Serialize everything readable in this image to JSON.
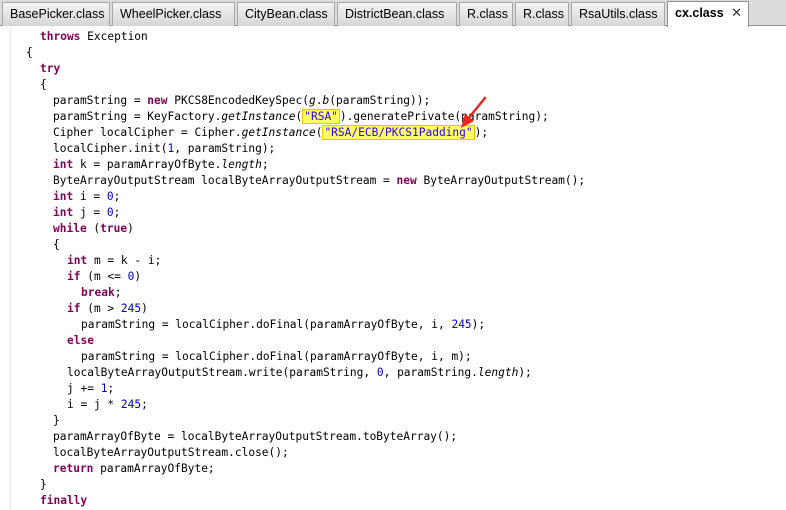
{
  "tabs": [
    {
      "label": "BasePicker.class"
    },
    {
      "label": "WheelPicker.class"
    },
    {
      "label": "CityBean.class"
    },
    {
      "label": "DistrictBean.class"
    },
    {
      "label": "R.class"
    },
    {
      "label": "R.class"
    },
    {
      "label": "RsaUtils.class"
    },
    {
      "label": "cx.class",
      "active": true,
      "close": "✕"
    }
  ],
  "code": {
    "l0": {
      "kw1": "throws",
      "t1": " Exception"
    },
    "l1": {
      "t1": "{"
    },
    "l2": {
      "kw1": "try"
    },
    "l3": {
      "t1": "{"
    },
    "l4": {
      "t1": "paramString = ",
      "kw1": "new",
      "t2": " PKCS8EncodedKeySpec(",
      "it1": "g",
      "t3": ".",
      "it2": "b",
      "t4": "(paramString));"
    },
    "l5": {
      "t1": "paramString = KeyFactory.",
      "it1": "getInstance",
      "t2": "(",
      "s1": "\"RSA\"",
      "t3": ").generatePrivate(paramString);"
    },
    "l6": {
      "t1": "Cipher localCipher = Cipher.",
      "it1": "getInstance",
      "t2": "(",
      "s1": "\"RSA/ECB/PKCS1Padding\"",
      "t3": ");"
    },
    "l7": {
      "t1": "localCipher.init(",
      "n1": "1",
      "t2": ", paramString);"
    },
    "l8": {
      "kw1": "int",
      "t1": " k = paramArrayOfByte.",
      "it1": "length",
      "t2": ";"
    },
    "l9": {
      "t1": "ByteArrayOutputStream localByteArrayOutputStream = ",
      "kw1": "new",
      "t2": " ByteArrayOutputStream();"
    },
    "l10": {
      "kw1": "int",
      "t1": " i = ",
      "n1": "0",
      "t2": ";"
    },
    "l11": {
      "kw1": "int",
      "t1": " j = ",
      "n1": "0",
      "t2": ";"
    },
    "l12": {
      "kw1": "while",
      "t1": " (",
      "kw2": "true",
      "t2": ")"
    },
    "l13": {
      "t1": "{"
    },
    "l14": {
      "kw1": "int",
      "t1": " m = k - i;"
    },
    "l15": {
      "kw1": "if",
      "t1": " (m <= ",
      "n1": "0",
      "t2": ")"
    },
    "l16": {
      "kw1": "break",
      "t1": ";"
    },
    "l17": {
      "kw1": "if",
      "t1": " (m > ",
      "n1": "245",
      "t2": ")"
    },
    "l18": {
      "t1": "paramString = localCipher.doFinal(paramArrayOfByte, i, ",
      "n1": "245",
      "t2": ");"
    },
    "l19": {
      "kw1": "else"
    },
    "l20": {
      "t1": "paramString = localCipher.doFinal(paramArrayOfByte, i, m);"
    },
    "l21": {
      "t1": "localByteArrayOutputStream.write(paramString, ",
      "n1": "0",
      "t2": ", paramString.",
      "it1": "length",
      "t3": ");"
    },
    "l22": {
      "t1": "j += ",
      "n1": "1",
      "t2": ";"
    },
    "l23": {
      "t1": "i = j * ",
      "n1": "245",
      "t2": ";"
    },
    "l24": {
      "t1": "}"
    },
    "l25": {
      "t1": "paramArrayOfByte = localByteArrayOutputStream.toByteArray();"
    },
    "l26": {
      "t1": "localByteArrayOutputStream.close();"
    },
    "l27": {
      "kw1": "return",
      "t1": " paramArrayOfByte;"
    },
    "l28": {
      "t1": "}"
    },
    "l29": {
      "kw1": "finally"
    }
  },
  "annotation": {
    "arrow_color": "#e8261b",
    "highlight_color": "#ffff66"
  }
}
